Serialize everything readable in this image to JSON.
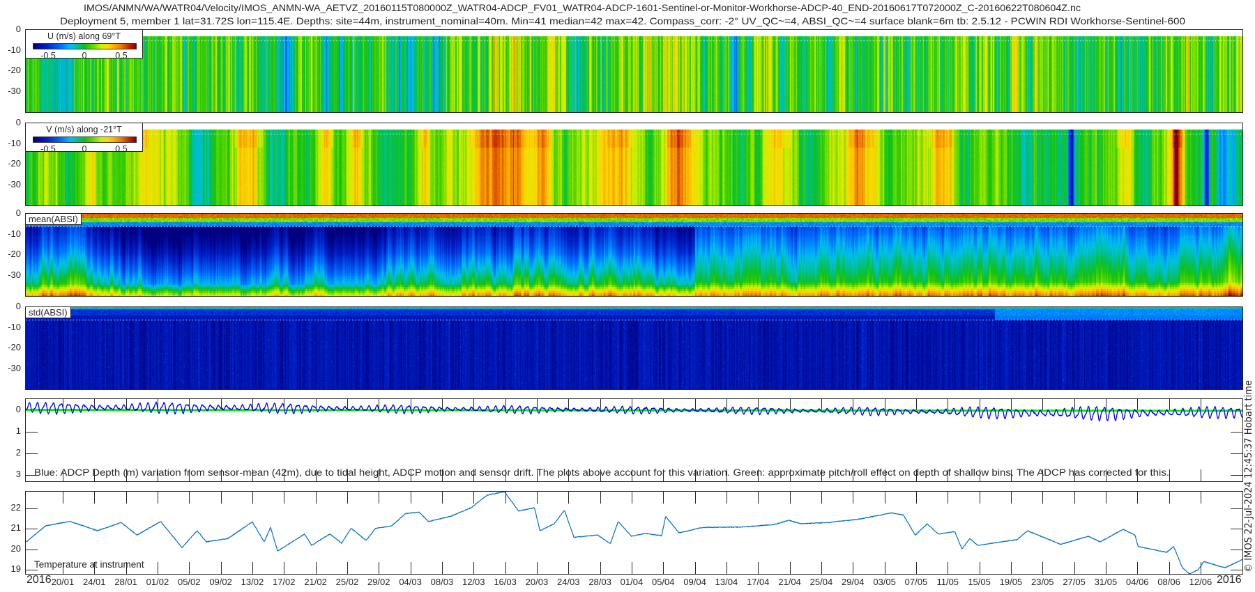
{
  "title": {
    "line1": "IMOS/ANMN/WA/WATR04/Velocity/IMOS_ANMN-WA_AETVZ_20160115T080000Z_WATR04-ADCP_FV01_WATR04-ADCP-1601-Sentinel-or-Monitor-Workhorse-ADCP-40_END-20160617T072000Z_C-20160622T080604Z.nc",
    "line2": "Deployment 5, member 1 lat=31.72S lon=115.4E. Depths: site=44m, instrument_nominal=40m. Min=41 median=42 max=42. Compass_corr: -2° UV_QC~=4, ABSI_QC~=4 surface blank=6m tb: 2.5.12 - PCWIN RDI Workhorse-Sentinel-600"
  },
  "stamp": "© IMOS 22-Jul-2024 12:45:37 Hobart time",
  "colormap": [
    [
      0,
      "#00007f"
    ],
    [
      0.13,
      "#0020c8"
    ],
    [
      0.27,
      "#0070ff"
    ],
    [
      0.36,
      "#00c0f0"
    ],
    [
      0.44,
      "#00c080"
    ],
    [
      0.5,
      "#10c010"
    ],
    [
      0.58,
      "#60d800"
    ],
    [
      0.66,
      "#d0f000"
    ],
    [
      0.73,
      "#ffd800"
    ],
    [
      0.85,
      "#f08000"
    ],
    [
      0.94,
      "#c02000"
    ],
    [
      1,
      "#7f0000"
    ]
  ],
  "x_axis": {
    "range_days": [
      15.33,
      169.3
    ],
    "start_label": "2016",
    "end_label": "2016",
    "first_tick_day": 20,
    "tick_step_days": 4,
    "tick_labels": [
      "20/01",
      "24/01",
      "28/01",
      "01/02",
      "05/02",
      "09/02",
      "13/02",
      "17/02",
      "21/02",
      "25/02",
      "29/02",
      "04/03",
      "08/03",
      "12/03",
      "16/03",
      "20/03",
      "24/03",
      "28/03",
      "01/04",
      "05/04",
      "09/04",
      "13/04",
      "17/04",
      "21/04",
      "25/04",
      "29/04",
      "03/05",
      "07/05",
      "11/05",
      "15/05",
      "19/05",
      "23/05",
      "27/05",
      "31/05",
      "04/06",
      "08/06",
      "12/06"
    ]
  },
  "chart_data": [
    {
      "id": "u",
      "type": "heatmap",
      "legend_title": "U (m/s) along 69°T",
      "colorbar_range": [
        -0.7,
        0.7
      ],
      "colorbar_ticks": [
        {
          "value": -0.5,
          "label": "-0.5"
        },
        {
          "value": 0,
          "label": "0"
        },
        {
          "value": 0.5,
          "label": "0.5"
        }
      ],
      "ylim": [
        -40,
        0
      ],
      "ytick_labels": [
        {
          "value": 0,
          "label": "0"
        },
        {
          "value": -10,
          "label": "-10"
        },
        {
          "value": -20,
          "label": "-20"
        },
        {
          "value": -30,
          "label": "-30"
        }
      ],
      "data_top_depth_m": 3,
      "dotted_line_depth_m": 5,
      "lowfreq_amplitude": 0.1,
      "highfreq_amplitude": 0.09
    },
    {
      "id": "v",
      "type": "heatmap",
      "legend_title": "V (m/s) along -21°T",
      "colorbar_range": [
        -0.7,
        0.7
      ],
      "colorbar_ticks": [
        {
          "value": -0.5,
          "label": "-0.5"
        },
        {
          "value": 0,
          "label": "0"
        },
        {
          "value": 0.5,
          "label": "0.5"
        }
      ],
      "ylim": [
        -40,
        0
      ],
      "ytick_labels": [
        {
          "value": 0,
          "label": "0"
        },
        {
          "value": -10,
          "label": "-10"
        },
        {
          "value": -20,
          "label": "-20"
        },
        {
          "value": -30,
          "label": "-30"
        }
      ],
      "data_top_depth_m": 3,
      "dotted_line_depth_m": 5,
      "events_day_width_value": [
        [
          18,
          2.5,
          0.25
        ],
        [
          23.5,
          3,
          0.3
        ],
        [
          30,
          4,
          0.25
        ],
        [
          43.5,
          4,
          0.45
        ],
        [
          53.6,
          2,
          0.3
        ],
        [
          57.2,
          3,
          0.25
        ],
        [
          65.8,
          2,
          0.3
        ],
        [
          73,
          4,
          0.45
        ],
        [
          77,
          5,
          0.5
        ],
        [
          81,
          2,
          0.4
        ],
        [
          90.5,
          5,
          0.3
        ],
        [
          98,
          4,
          0.35
        ],
        [
          111,
          4,
          0.3
        ],
        [
          121,
          5,
          0.3
        ],
        [
          131,
          5,
          0.3
        ],
        [
          147.7,
          0.8,
          -0.55
        ],
        [
          154.3,
          3,
          0.3
        ],
        [
          161.1,
          1.5,
          0.5
        ],
        [
          164.8,
          0.8,
          -0.5
        ],
        [
          167,
          2,
          -0.2
        ]
      ]
    },
    {
      "id": "mean_absi",
      "type": "heatmap",
      "label": "mean(ABSI)",
      "color_scale": "normalized 0-1",
      "ylim": [
        -40,
        0
      ],
      "ytick_labels": [
        {
          "value": 0,
          "label": "0"
        },
        {
          "value": -10,
          "label": "-10"
        },
        {
          "value": -20,
          "label": "-20"
        },
        {
          "value": -30,
          "label": "-30"
        }
      ],
      "dotted_line_depth_m": 6,
      "regime_change_day": 100
    },
    {
      "id": "std_absi",
      "type": "heatmap",
      "label": "std(ABSI)",
      "color_scale": "normalized 0-1",
      "ylim": [
        -40,
        0
      ],
      "ytick_labels": [
        {
          "value": 0,
          "label": "0"
        },
        {
          "value": -10,
          "label": "-10"
        },
        {
          "value": -20,
          "label": "-20"
        },
        {
          "value": -30,
          "label": "-30"
        }
      ],
      "dotted_line_depth_m": 6,
      "surface_change_day": 138
    },
    {
      "id": "depth_variation",
      "type": "line",
      "caption": "Blue: ADCP Depth (m) variation from sensor-mean (42m), due to tidal height, ADCP motion and sensor drift. The plots above account for this variation. Green: approximate pitch/roll effect on depth of shallow bins. The ADCP has corrected for this.",
      "ylim": [
        -0.5,
        3.3
      ],
      "y_reversed": true,
      "ytick_labels": [
        {
          "value": 0,
          "label": "0"
        },
        {
          "value": 1,
          "label": "1"
        },
        {
          "value": 2,
          "label": "2"
        },
        {
          "value": 3,
          "label": "3"
        }
      ],
      "tidal_period_days": 1.0,
      "series": [
        {
          "name": "ADCP depth variation",
          "color": "#0000ff",
          "mean_offset_day_value": [
            [
              15,
              -0.1
            ],
            [
              40,
              -0.1
            ],
            [
              60,
              -0.05
            ],
            [
              90,
              0.0
            ],
            [
              120,
              0.05
            ],
            [
              135,
              0.1
            ],
            [
              145,
              0.16
            ],
            [
              155,
              0.15
            ],
            [
              169.3,
              0.1
            ]
          ],
          "amplitude_day_value": [
            [
              15,
              0.2
            ],
            [
              40,
              0.2
            ],
            [
              60,
              0.15
            ],
            [
              100,
              0.12
            ],
            [
              130,
              0.15
            ],
            [
              145,
              0.27
            ],
            [
              169.3,
              0.2
            ]
          ]
        },
        {
          "name": "pitch/roll effect",
          "color": "#00ee00",
          "day_value": [
            [
              15,
              0.0
            ],
            [
              90,
              0.02
            ],
            [
              169.3,
              0.04
            ]
          ]
        }
      ]
    },
    {
      "id": "temperature",
      "type": "line",
      "label": "Temperature at instrument",
      "ylim": [
        18.8,
        22.8
      ],
      "ytick_labels": [
        {
          "value": 19,
          "label": "19"
        },
        {
          "value": 20,
          "label": "20"
        },
        {
          "value": 21,
          "label": "21"
        },
        {
          "value": 22,
          "label": "22"
        }
      ],
      "color": "#0072bd",
      "day_value": [
        [
          15.3,
          20.33
        ],
        [
          17.8,
          21.13
        ],
        [
          20.9,
          21.36
        ],
        [
          24.4,
          20.9
        ],
        [
          27.4,
          21.3
        ],
        [
          29.4,
          20.69
        ],
        [
          32.4,
          21.35
        ],
        [
          35.1,
          20.08
        ],
        [
          37.0,
          20.9
        ],
        [
          38.2,
          20.36
        ],
        [
          40.9,
          20.52
        ],
        [
          44.0,
          21.33
        ],
        [
          45.5,
          20.36
        ],
        [
          46.3,
          21.06
        ],
        [
          47.2,
          19.91
        ],
        [
          50.6,
          20.74
        ],
        [
          51.5,
          20.19
        ],
        [
          53.8,
          20.74
        ],
        [
          55.3,
          20.3
        ],
        [
          56.5,
          21.02
        ],
        [
          58.4,
          20.43
        ],
        [
          59.6,
          21.02
        ],
        [
          61.6,
          21.13
        ],
        [
          63.4,
          21.74
        ],
        [
          65.1,
          21.8
        ],
        [
          66.3,
          21.35
        ],
        [
          69.1,
          21.6
        ],
        [
          71.7,
          22.02
        ],
        [
          73.7,
          22.63
        ],
        [
          75.9,
          22.8
        ],
        [
          77.7,
          21.86
        ],
        [
          79.7,
          22.02
        ],
        [
          80.4,
          20.9
        ],
        [
          82.2,
          21.24
        ],
        [
          83.5,
          21.9
        ],
        [
          84.7,
          20.58
        ],
        [
          87.7,
          20.69
        ],
        [
          89.3,
          20.27
        ],
        [
          90.3,
          21.35
        ],
        [
          92.0,
          20.63
        ],
        [
          93.7,
          20.77
        ],
        [
          95.8,
          20.66
        ],
        [
          96.3,
          21.6
        ],
        [
          98.0,
          20.8
        ],
        [
          101.0,
          21.06
        ],
        [
          105.9,
          21.08
        ],
        [
          110.0,
          21.2
        ],
        [
          111.9,
          21.41
        ],
        [
          113.4,
          21.24
        ],
        [
          116.9,
          21.3
        ],
        [
          120.9,
          21.47
        ],
        [
          124.9,
          21.77
        ],
        [
          126.4,
          21.66
        ],
        [
          127.9,
          20.69
        ],
        [
          129.4,
          21.24
        ],
        [
          130.8,
          20.74
        ],
        [
          132.9,
          20.86
        ],
        [
          133.8,
          20.0
        ],
        [
          134.8,
          20.52
        ],
        [
          135.8,
          20.19
        ],
        [
          140.8,
          20.47
        ],
        [
          142.1,
          20.9
        ],
        [
          143.8,
          20.63
        ],
        [
          146.3,
          20.24
        ],
        [
          149.8,
          20.63
        ],
        [
          151.3,
          20.36
        ],
        [
          154.2,
          20.97
        ],
        [
          155.7,
          20.69
        ],
        [
          156.1,
          20.13
        ],
        [
          159.7,
          19.85
        ],
        [
          160.6,
          20.13
        ],
        [
          161.7,
          19.1
        ],
        [
          162.6,
          18.8
        ],
        [
          163.7,
          19.0
        ],
        [
          164.4,
          19.4
        ],
        [
          167.1,
          19.1
        ],
        [
          169.3,
          19.5
        ]
      ]
    }
  ]
}
